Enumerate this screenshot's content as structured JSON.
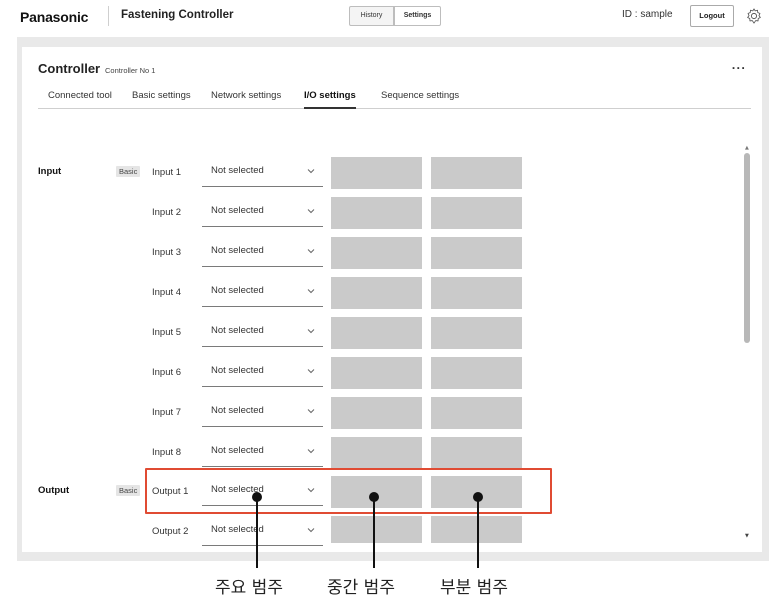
{
  "header": {
    "brand": "Panasonic",
    "app_title": "Fastening Controller",
    "history_label": "History",
    "settings_label": "Settings",
    "user_id": "ID : sample",
    "logout_label": "Logout",
    "settings_icon": "gear-icon"
  },
  "controller": {
    "title": "Controller",
    "subtitle": "Controller No 1",
    "more_label": "..."
  },
  "tabs": [
    {
      "label": "Connected tool"
    },
    {
      "label": "Basic settings"
    },
    {
      "label": "Network settings"
    },
    {
      "label": "I/O settings",
      "active": true
    },
    {
      "label": "Sequence settings"
    }
  ],
  "io": {
    "input_section": "Input",
    "output_section": "Output",
    "basic_badge": "Basic",
    "select_value": "Not selected",
    "rows": [
      {
        "label": "Input 1",
        "value": "Not selected"
      },
      {
        "label": "Input 2",
        "value": "Not selected"
      },
      {
        "label": "Input 3",
        "value": "Not selected"
      },
      {
        "label": "Input 4",
        "value": "Not selected"
      },
      {
        "label": "Input 5",
        "value": "Not selected"
      },
      {
        "label": "Input 6",
        "value": "Not selected"
      },
      {
        "label": "Input 7",
        "value": "Not selected"
      },
      {
        "label": "Input 8",
        "value": "Not selected"
      },
      {
        "label": "Output 1",
        "value": "Not selected"
      },
      {
        "label": "Output 2",
        "value": "Not selected"
      }
    ]
  },
  "annotations": {
    "main_category": "주요 범주",
    "middle_category": "중간 범주",
    "sub_category": "부분 범주",
    "highlight_color": "#e04b33"
  },
  "colors": {
    "frame_bg": "#e9e9e9",
    "cell_bg": "#cacaca"
  }
}
